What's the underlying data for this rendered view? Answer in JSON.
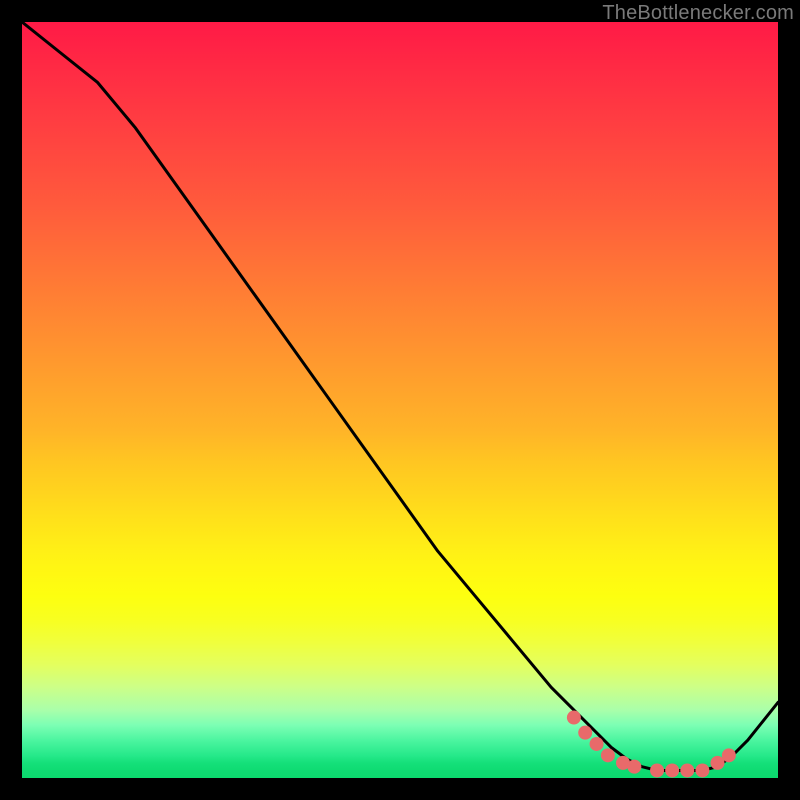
{
  "watermark": "TheBottlenecker.com",
  "chart_data": {
    "type": "line",
    "title": "",
    "xlabel": "",
    "ylabel": "",
    "xlim": [
      0,
      100
    ],
    "ylim": [
      0,
      100
    ],
    "x": [
      0,
      5,
      10,
      15,
      20,
      25,
      30,
      35,
      40,
      45,
      50,
      55,
      60,
      65,
      70,
      72,
      74,
      76,
      78,
      80,
      82,
      84,
      86,
      88,
      90,
      92,
      94,
      96,
      98,
      100
    ],
    "y": [
      100,
      96,
      92,
      86,
      79,
      72,
      65,
      58,
      51,
      44,
      37,
      30,
      24,
      18,
      12,
      10,
      8,
      6,
      4,
      2.5,
      1.5,
      1,
      1,
      1,
      1,
      1.5,
      3,
      5,
      7.5,
      10
    ],
    "flat_region_x": [
      74,
      92
    ],
    "marker_color": "#e86a6a",
    "markers_x": [
      73,
      74.5,
      76,
      77.5,
      79.5,
      81,
      84,
      86,
      88,
      90,
      92,
      93.5
    ],
    "markers_y": [
      8,
      6,
      4.5,
      3,
      2,
      1.5,
      1,
      1,
      1,
      1,
      2,
      3
    ]
  }
}
